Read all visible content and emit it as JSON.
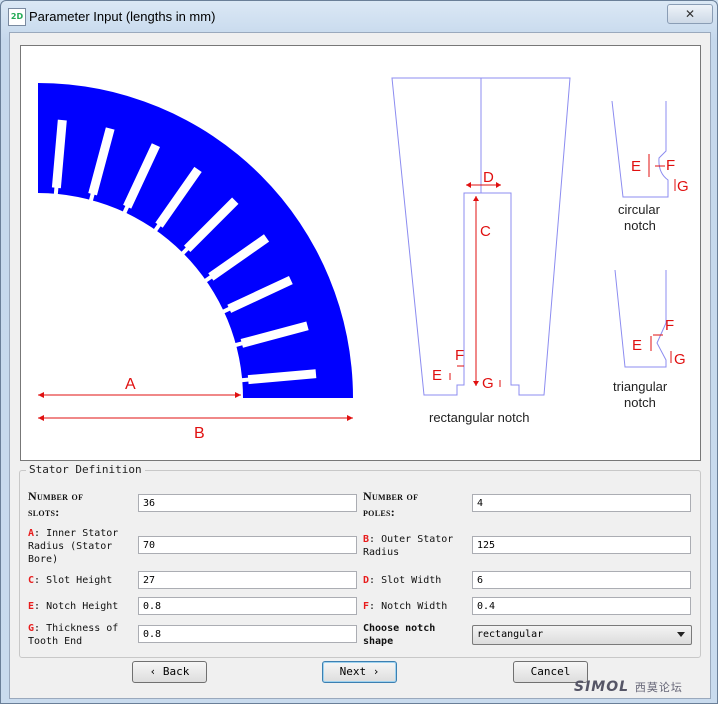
{
  "window": {
    "title": "Parameter Input (lengths in mm)",
    "close_label": "✕",
    "app_icon_label": "2D"
  },
  "figure": {
    "arrow_a": "A",
    "arrow_b": "B",
    "rect_c": "C",
    "rect_d": "D",
    "rect_e": "E",
    "rect_f": "F",
    "rect_g": "G",
    "rect_caption": "rectangular notch",
    "circ_e": "E",
    "circ_f": "F",
    "circ_g": "G",
    "circ_caption_1": "circular",
    "circ_caption_2": "notch",
    "tri_e": "E",
    "tri_f": "F",
    "tri_g": "G",
    "tri_caption_1": "triangular",
    "tri_caption_2": "notch",
    "stator_color": "#0000ff",
    "dimension_color": "#e01010",
    "outline_color": "#8c8cf0"
  },
  "stator_definition": {
    "legend": "Stator Definition",
    "num_slots": {
      "label_1": "Number of",
      "label_2": "slots:",
      "value": "36"
    },
    "num_poles": {
      "label_1": "Number of",
      "label_2": "poles:",
      "value": "4"
    },
    "inner_radius": {
      "key": "A",
      "label_1": ": Inner Stator",
      "label_2": "Radius (Stator",
      "label_3": "Bore)",
      "value": "70"
    },
    "outer_radius": {
      "key": "B",
      "label_1": ": Outer Stator",
      "label_2": "Radius",
      "value": "125"
    },
    "slot_height": {
      "key": "C",
      "label": ": Slot Height",
      "value": "27"
    },
    "slot_width": {
      "key": "D",
      "label": ": Slot Width",
      "value": "6"
    },
    "notch_height": {
      "key": "E",
      "label": ": Notch Height",
      "value": "0.8"
    },
    "notch_width": {
      "key": "F",
      "label": ": Notch Width",
      "value": "0.4"
    },
    "tooth_end": {
      "key": "G",
      "label_1": ": Thickness of",
      "label_2": "Tooth End",
      "value": "0.8"
    },
    "notch_shape": {
      "label_1": "Choose notch",
      "label_2": "shape",
      "value": "rectangular"
    }
  },
  "buttons": {
    "back": "‹ Back",
    "next": "Next ›",
    "cancel": "Cancel"
  },
  "watermark": {
    "brand": "SIMOL",
    "cn": "西莫论坛"
  }
}
